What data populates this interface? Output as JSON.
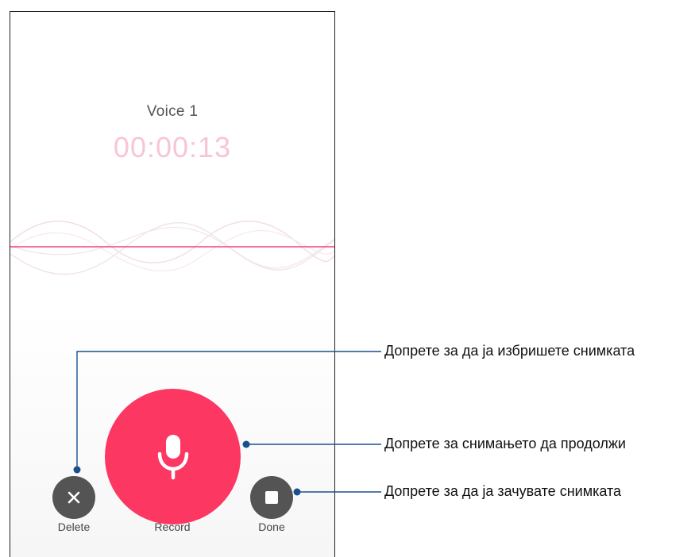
{
  "recording": {
    "title": "Voice 1",
    "elapsed": "00:00:13"
  },
  "controls": {
    "delete_label": "Delete",
    "record_label": "Record",
    "done_label": "Done"
  },
  "icons": {
    "delete": "close-icon",
    "record": "microphone-icon",
    "done": "stop-icon"
  },
  "callouts": {
    "delete": "Допрете за да ја избришете снимката",
    "record": "Допрете за снимањето да продолжи",
    "done": "Допрете за да ја зачувате снимката"
  },
  "colors": {
    "accent": "#fb3762",
    "timer": "#f7c6d5",
    "secondary_button": "#545454",
    "callout": "#1a4f8f"
  }
}
